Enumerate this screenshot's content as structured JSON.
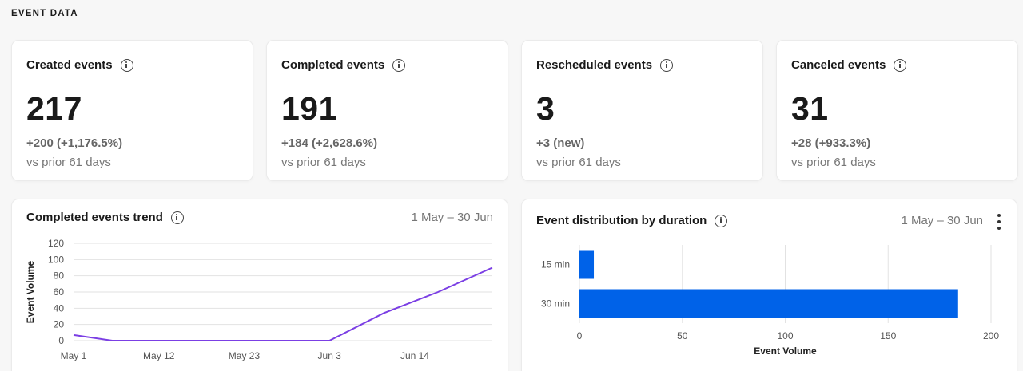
{
  "section": {
    "title": "EVENT DATA"
  },
  "stats": [
    {
      "label": "Created events",
      "value": "217",
      "change": "+200 (+1,176.5%)",
      "comparison": "vs prior 61 days"
    },
    {
      "label": "Completed events",
      "value": "191",
      "change": "+184 (+2,628.6%)",
      "comparison": "vs prior 61 days"
    },
    {
      "label": "Rescheduled events",
      "value": "3",
      "change": "+3 (new)",
      "comparison": "vs prior 61 days"
    },
    {
      "label": "Canceled events",
      "value": "31",
      "change": "+28 (+933.3%)",
      "comparison": "vs prior 61 days"
    }
  ],
  "trend": {
    "title": "Completed events trend",
    "date_range": "1 May – 30 Jun"
  },
  "distribution": {
    "title": "Event distribution by duration",
    "date_range": "1 May – 30 Jun"
  },
  "colors": {
    "line": "#7b3fe4",
    "bar": "#0062e8",
    "grid": "#e2e2e2"
  },
  "chart_data": [
    {
      "type": "line",
      "title": "Completed events trend",
      "ylabel": "Event Volume",
      "xlabel": "",
      "ylim": [
        0,
        120
      ],
      "yticks": [
        0,
        20,
        40,
        60,
        80,
        100,
        120
      ],
      "x_tick_labels": [
        "May 1",
        "May 12",
        "May 23",
        "Jun 3",
        "Jun 14"
      ],
      "x_tick_positions": [
        0,
        11,
        22,
        33,
        44
      ],
      "x_range": [
        0,
        54
      ],
      "series": [
        {
          "x": [
            0,
            5,
            33,
            40,
            47,
            54
          ],
          "values": [
            7,
            0,
            0,
            34,
            60,
            90
          ]
        }
      ],
      "grid": true
    },
    {
      "type": "bar",
      "orientation": "horizontal",
      "title": "Event distribution by duration",
      "categories": [
        "15 min",
        "30 min"
      ],
      "values": [
        7,
        184
      ],
      "xlabel": "Event Volume",
      "xlim": [
        0,
        200
      ],
      "xticks": [
        0,
        50,
        100,
        150,
        200
      ],
      "grid": true
    }
  ]
}
